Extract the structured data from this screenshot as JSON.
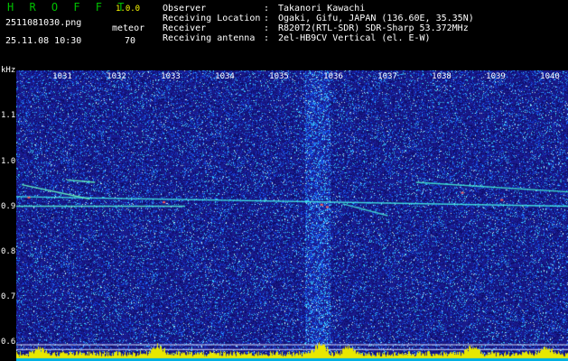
{
  "app": {
    "title": "H R O F F T",
    "version": "1.0.0"
  },
  "info": {
    "filename": "2511081030.png",
    "datetime": "25.11.08 10:30",
    "meteor_label": "meteor",
    "meteor_count": "70"
  },
  "meta": [
    {
      "key": "Observer",
      "sep": ":",
      "value": "Takanori Kawachi"
    },
    {
      "key": "Receiving Location",
      "sep": ":",
      "value": "Ogaki, Gifu, JAPAN (136.60E, 35.35N)"
    },
    {
      "key": "Receiver",
      "sep": ":",
      "value": "R820T2(RTL-SDR) SDR-Sharp 53.372MHz"
    },
    {
      "key": "Receiving antenna",
      "sep": ":",
      "value": "2el-HB9CV Vertical (el. E-W)"
    }
  ],
  "spectrogram": {
    "y_unit": "kHz",
    "y_ticks": [
      "1.1",
      "1.0",
      "0.9",
      "0.8",
      "0.7",
      "0.6"
    ],
    "x_ticks": [
      "1031",
      "1032",
      "1033",
      "1034",
      "1035",
      "1036",
      "1037",
      "1038",
      "1039",
      "1040"
    ],
    "x_range": [
      1030.5,
      1040.3
    ],
    "y_range": [
      0.58,
      1.19
    ],
    "background_color": "#1a1a8c",
    "strong_band_minute": 1035.85
  }
}
